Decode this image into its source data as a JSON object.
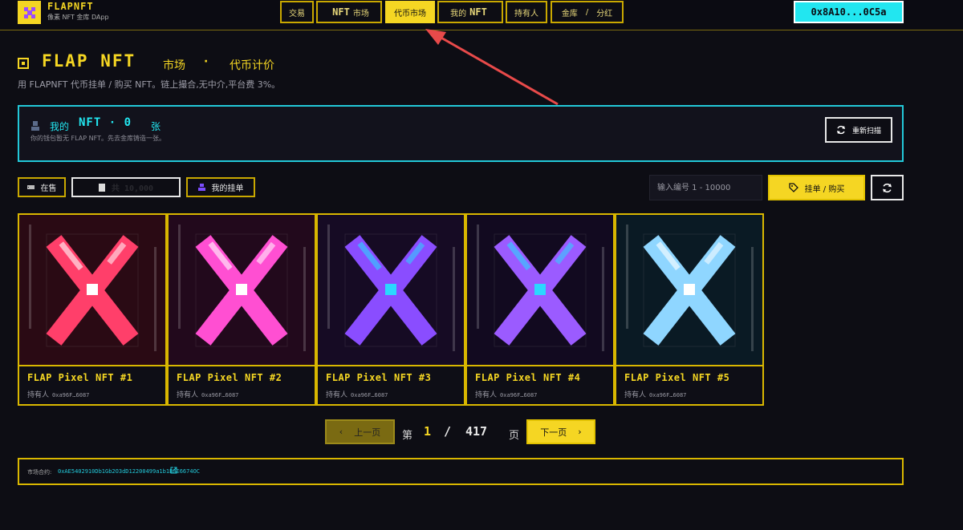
{
  "brand": {
    "name": "FLAPNFT",
    "subtitle": "像素 NFT 金库 DApp"
  },
  "nav": {
    "trade": "交易",
    "nft_market_px": "NFT",
    "nft_market_suffix": "市场",
    "token_market": "代币市场",
    "mine_prefix": "我的",
    "mine_px": "NFT",
    "holders": "持有人",
    "vault_prefix": "金库",
    "vault_slash": "/",
    "vault_suffix": "分红"
  },
  "wallet": {
    "address": "0x8A10...0C5a"
  },
  "heading": {
    "title": "FLAP NFT",
    "sub1": "市场",
    "dot": "·",
    "sub2": "代币计价",
    "description": "用 FLAPNFT 代币挂单 / 购买 NFT。链上撮合,无中介,平台费 3%。"
  },
  "my_panel": {
    "label": "我的",
    "count_text": "NFT · 0",
    "unit": "张",
    "hint": "你的钱包暂无 FLAP NFT。先去金库铸造一张。",
    "rescan": "重新扫描"
  },
  "filters": {
    "on_sale": "在售",
    "count_tab": "共 10,000",
    "my_listings": "我的挂单",
    "search_placeholder": "输入编号 1 - 10000",
    "list_buy": "挂单 / 购买"
  },
  "cards": [
    {
      "title": "FLAP Pixel NFT #1",
      "owner_label": "持有人",
      "owner": "0xa96F…6087",
      "bg": "#2a0a14",
      "wing": "#ff3f6a",
      "accent": "#ffffff"
    },
    {
      "title": "FLAP Pixel NFT #2",
      "owner_label": "持有人",
      "owner": "0xa96F…6087",
      "bg": "#22091c",
      "wing": "#ff4fd2",
      "accent": "#ffffff"
    },
    {
      "title": "FLAP Pixel NFT #3",
      "owner_label": "持有人",
      "owner": "0xa96F…6087",
      "bg": "#160b24",
      "wing": "#8a4dff",
      "accent": "#2ad8ff"
    },
    {
      "title": "FLAP Pixel NFT #4",
      "owner_label": "持有人",
      "owner": "0xa96F…6087",
      "bg": "#120a20",
      "wing": "#9b5bff",
      "accent": "#2ad8ff"
    },
    {
      "title": "FLAP Pixel NFT #5",
      "owner_label": "持有人",
      "owner": "0xa96F…6087",
      "bg": "#0a1a24",
      "wing": "#8fd6ff",
      "accent": "#ffffff"
    }
  ],
  "pagination": {
    "prev": "上一页",
    "page_word": "第",
    "current": "1",
    "slash": "/",
    "total": "417",
    "page_suffix": "页",
    "next": "下一页"
  },
  "footer": {
    "label": "市场合约:",
    "address": "0xAE5402910Db1Gb2O3dD12200499a1b1B0E6674OC"
  },
  "colors": {
    "accent": "#f5d623",
    "cyan": "#22e6f0",
    "background": "#0d0d14"
  }
}
